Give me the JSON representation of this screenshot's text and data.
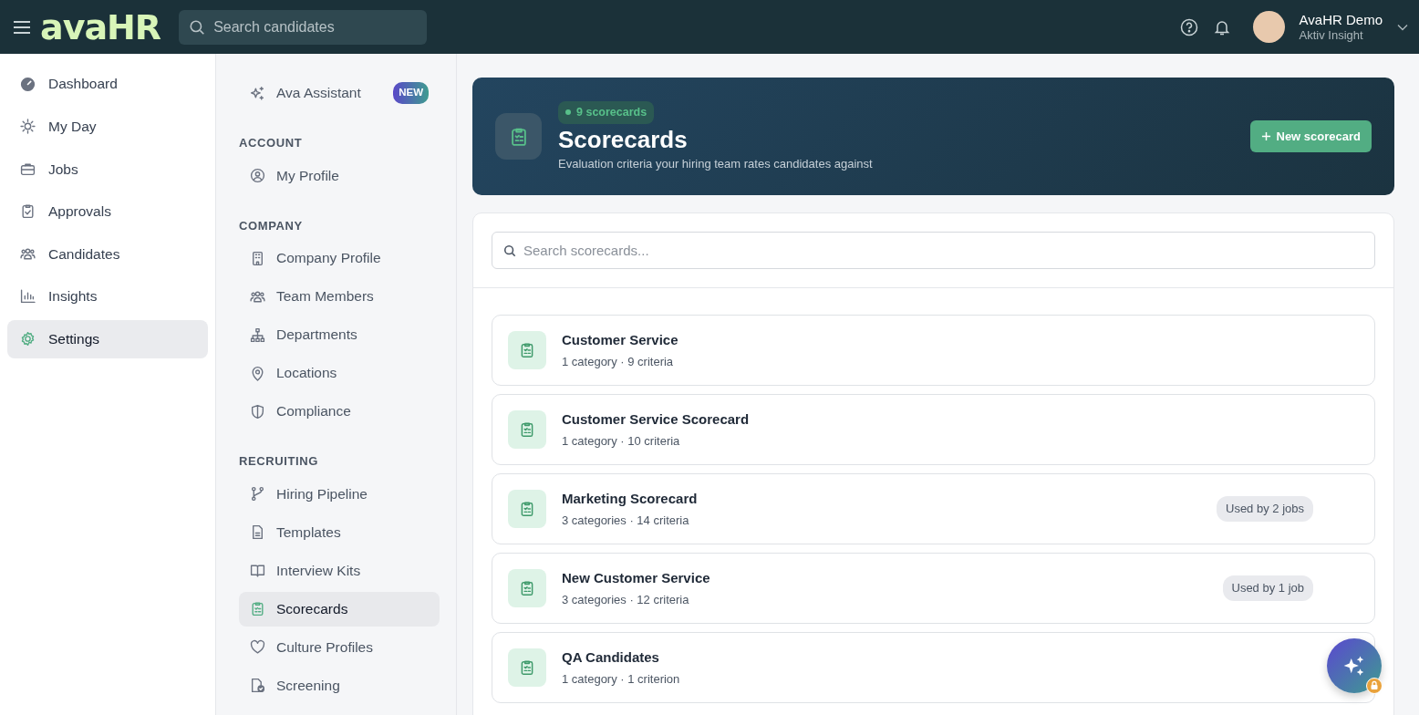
{
  "topbar": {
    "logo": "avaHR",
    "search": {
      "placeholder": "Search candidates"
    },
    "user": {
      "name": "AvaHR Demo",
      "company": "Aktiv Insight"
    }
  },
  "sidebar": {
    "items": [
      {
        "label": "Dashboard",
        "selected": false
      },
      {
        "label": "My Day",
        "selected": false
      },
      {
        "label": "Jobs",
        "selected": false
      },
      {
        "label": "Approvals",
        "selected": false
      },
      {
        "label": "Candidates",
        "selected": false
      },
      {
        "label": "Insights",
        "selected": false
      },
      {
        "label": "Settings",
        "selected": true
      }
    ]
  },
  "settings_nav": {
    "top_item": {
      "label": "Ava Assistant",
      "badge": "NEW"
    },
    "sections": [
      {
        "heading": "ACCOUNT",
        "items": [
          {
            "label": "My Profile",
            "selected": false
          }
        ]
      },
      {
        "heading": "COMPANY",
        "items": [
          {
            "label": "Company Profile",
            "selected": false
          },
          {
            "label": "Team Members",
            "selected": false
          },
          {
            "label": "Departments",
            "selected": false
          },
          {
            "label": "Locations",
            "selected": false
          },
          {
            "label": "Compliance",
            "selected": false
          }
        ]
      },
      {
        "heading": "RECRUITING",
        "items": [
          {
            "label": "Hiring Pipeline",
            "selected": false
          },
          {
            "label": "Templates",
            "selected": false
          },
          {
            "label": "Interview Kits",
            "selected": false
          },
          {
            "label": "Scorecards",
            "selected": true
          },
          {
            "label": "Culture Profiles",
            "selected": false
          },
          {
            "label": "Screening",
            "selected": false
          }
        ]
      }
    ]
  },
  "header": {
    "count_badge": "9 scorecards",
    "title": "Scorecards",
    "subtitle": "Evaluation criteria your hiring team rates candidates against",
    "button": "New scorecard"
  },
  "search": {
    "placeholder": "Search scorecards..."
  },
  "scorecards": [
    {
      "name": "Customer Service",
      "meta": "1 category · 9 criteria"
    },
    {
      "name": "Customer Service Scorecard",
      "meta": "1 category · 10 criteria"
    },
    {
      "name": "Marketing Scorecard",
      "meta": "3 categories · 14 criteria",
      "usage": "Used by 2 jobs"
    },
    {
      "name": "New Customer Service",
      "meta": "3 categories · 12 criteria",
      "usage": "Used by 1 job"
    },
    {
      "name": "QA Candidates",
      "meta": "1 category · 1 criterion"
    }
  ]
}
